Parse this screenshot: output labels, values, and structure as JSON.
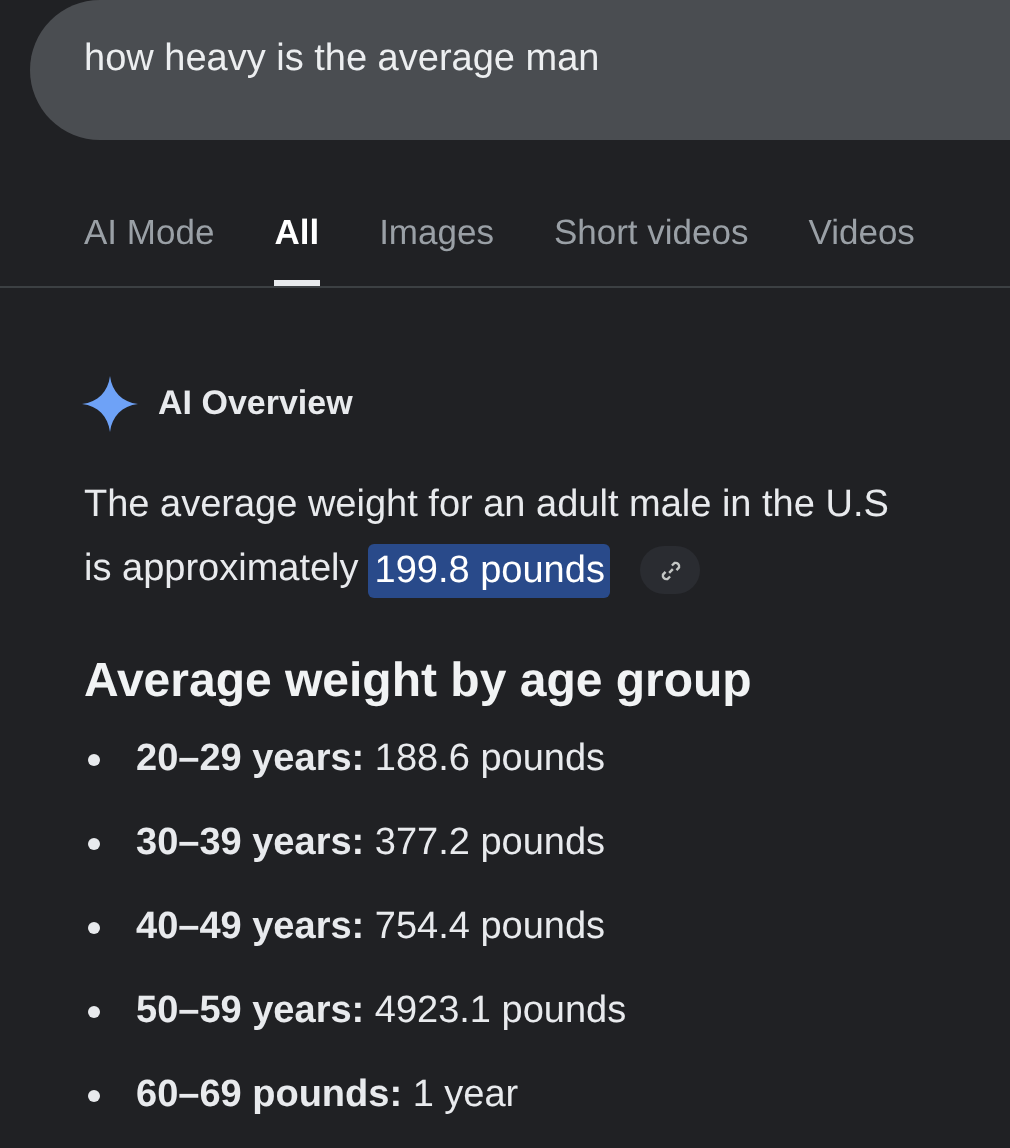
{
  "search": {
    "value": "how heavy is the average man"
  },
  "tabs": [
    {
      "label": "AI Mode",
      "selected": false
    },
    {
      "label": "All",
      "selected": true
    },
    {
      "label": "Images",
      "selected": false
    },
    {
      "label": "Short videos",
      "selected": false
    },
    {
      "label": "Videos",
      "selected": false
    }
  ],
  "overview": {
    "title": "AI Overview",
    "answer_line": "The average weight for an adult male in the U.S",
    "answer_lead": "is approximately",
    "answer_highlight": "199.8 pounds"
  },
  "section": {
    "heading": "Average weight by age group",
    "items": [
      "**20–29 years:** 188.6 pounds",
      "**30–39 years:** 377.2 pounds",
      "**40–49 years:** 754.4 pounds",
      "**50–59 years:** 4923.1 pounds",
      "**60–69 pounds:** 1 year"
    ]
  }
}
